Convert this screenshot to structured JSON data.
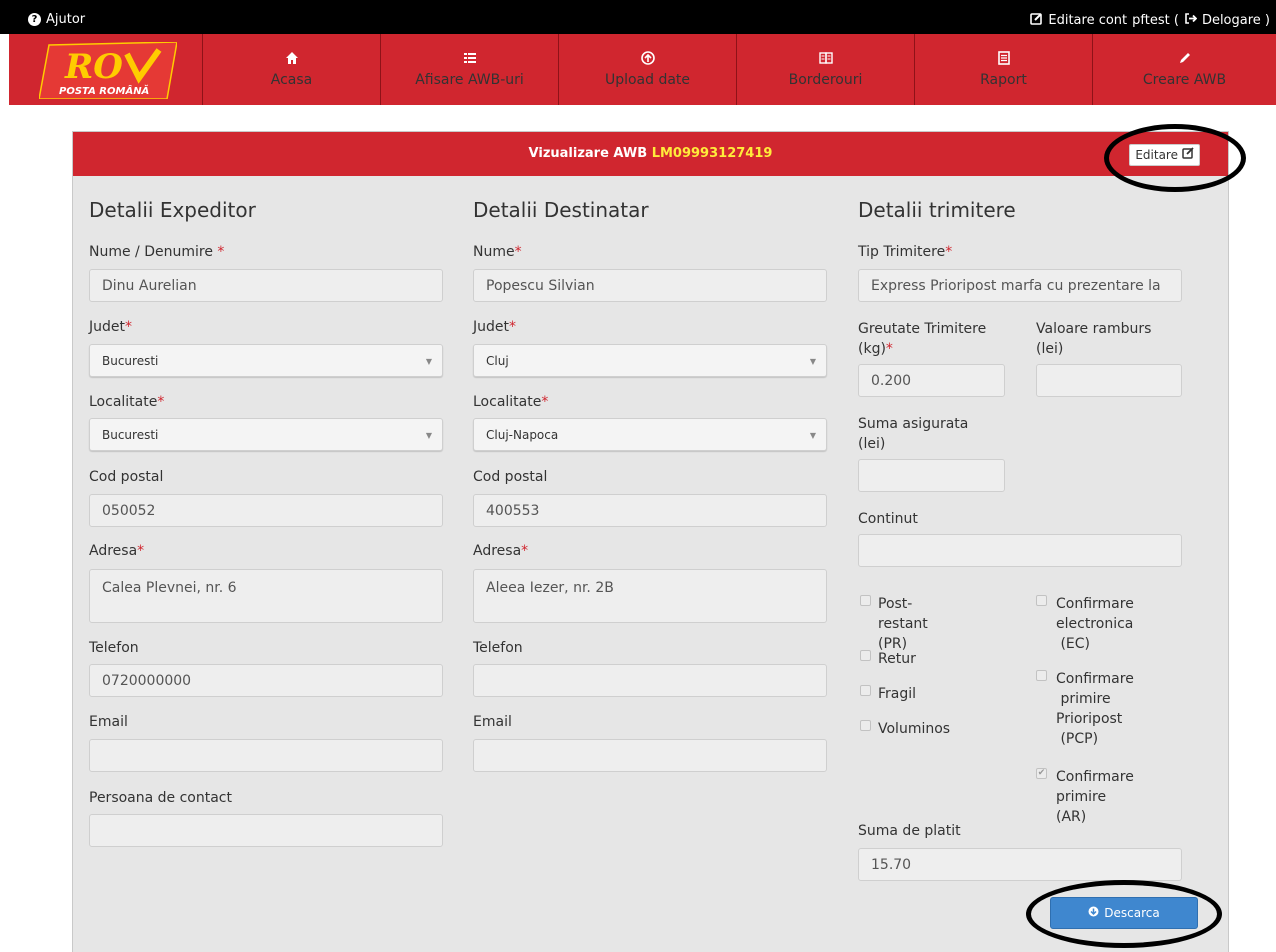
{
  "topbar": {
    "help": "Ajutor",
    "edit_account": "Editare cont",
    "user": "pftest (",
    "logout": "Delogare )"
  },
  "logo": {
    "brand": "POSTA ROMÂNĂ"
  },
  "nav": {
    "items": [
      {
        "label": "Acasa",
        "icon": "home-icon"
      },
      {
        "label": "Afisare AWB-uri",
        "icon": "list-icon"
      },
      {
        "label": "Upload date",
        "icon": "upload-icon"
      },
      {
        "label": "Borderouri",
        "icon": "documents-icon"
      },
      {
        "label": "Raport",
        "icon": "report-icon"
      },
      {
        "label": "Creare AWB",
        "icon": "pencil-icon"
      }
    ]
  },
  "panel": {
    "title": "Vizualizare AWB",
    "awb_number": "LM09993127419",
    "edit_button": "Editare"
  },
  "sender": {
    "heading": "Detalii Expeditor",
    "name_label": "Nume / Denumire",
    "name_value": "Dinu Aurelian",
    "county_label": "Judet",
    "county_value": "Bucuresti",
    "city_label": "Localitate",
    "city_value": "Bucuresti",
    "postal_label": "Cod postal",
    "postal_value": "050052",
    "address_label": "Adresa",
    "address_value": "Calea Plevnei, nr. 6",
    "phone_label": "Telefon",
    "phone_value": "0720000000",
    "email_label": "Email",
    "email_value": "",
    "contact_label": "Persoana de contact",
    "contact_value": ""
  },
  "recipient": {
    "heading": "Detalii Destinatar",
    "name_label": "Nume",
    "name_value": "Popescu Silvian",
    "county_label": "Judet",
    "county_value": "Cluj",
    "city_label": "Localitate",
    "city_value": "Cluj-Napoca",
    "postal_label": "Cod postal",
    "postal_value": "400553",
    "address_label": "Adresa",
    "address_value": "Aleea Iezer, nr. 2B",
    "phone_label": "Telefon",
    "phone_value": "",
    "email_label": "Email",
    "email_value": ""
  },
  "shipment": {
    "heading": "Detalii trimitere",
    "type_label": "Tip Trimitere",
    "type_value": "Express Prioripost marfa cu prezentare la",
    "weight_label_1": "Greutate Trimitere",
    "weight_label_2": "(kg)",
    "weight_value": "0.200",
    "cod_label_1": "Valoare ramburs",
    "cod_label_2": "(lei)",
    "cod_value": "",
    "insured_label_1": "Suma asigurata",
    "insured_label_2": "(lei)",
    "insured_value": "",
    "content_label": "Continut",
    "content_value": "",
    "options": {
      "pr": {
        "lines": [
          "Post-restant",
          "(PR)"
        ],
        "checked": false
      },
      "retur": {
        "lines": [
          "Retur"
        ],
        "checked": false
      },
      "fragil": {
        "lines": [
          "Fragil"
        ],
        "checked": false
      },
      "voluminos": {
        "lines": [
          "Voluminos"
        ],
        "checked": false
      },
      "ec": {
        "lines": [
          "Confirmare",
          "electronica",
          "(EC)"
        ],
        "checked": false
      },
      "pcp": {
        "lines": [
          "Confirmare",
          "primire",
          "Prioripost",
          "(PCP)"
        ],
        "checked": false
      },
      "ar": {
        "lines": [
          "Confirmare",
          "primire (AR)"
        ],
        "checked": true
      }
    },
    "total_label": "Suma de platit",
    "total_value": "15.70",
    "download_button": "Descarca"
  }
}
